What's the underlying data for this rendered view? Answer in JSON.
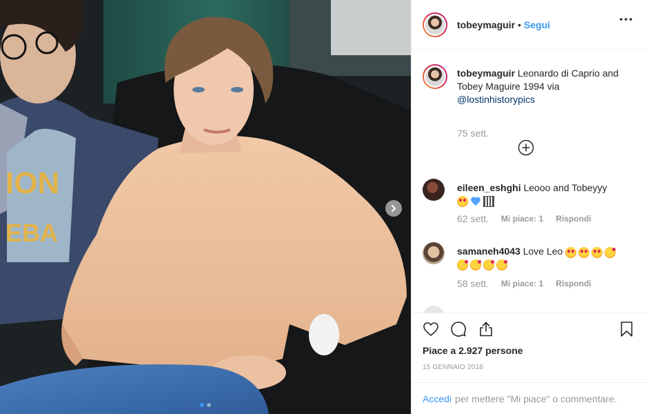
{
  "post": {
    "author": "tobeymaguir",
    "separator": "•",
    "follow_label": "Segui",
    "caption_text": "Leonardo di Caprio and Tobey Maguire 1994 via",
    "caption_mention": "@lostinhistorypics",
    "caption_time": "75 sett.",
    "likes_text": "Piace a 2.927 persone",
    "date": "15 GENNAIO 2018",
    "login_link": "Accedi",
    "login_text": "per mettere \"Mi piace\" o commentare.",
    "carousel_current": 1,
    "carousel_total": 2
  },
  "comments": [
    {
      "user": "eileen_eshghi",
      "text": "Leooo and Tobeyyy",
      "emojis": [
        "heart-eyes-emoji",
        "blue-heart-emoji",
        "qr-emoji"
      ],
      "time": "62 sett.",
      "likes": "Mi piace: 1",
      "reply": "Rispondi"
    },
    {
      "user": "samaneh4043",
      "text": "Love Leo",
      "emojis_inline": [
        "heart-eyes-emoji",
        "heart-eyes-emoji",
        "heart-eyes-emoji",
        "kiss-emoji"
      ],
      "emojis": [
        "kiss-emoji",
        "kiss-emoji",
        "kiss-emoji",
        "kiss-emoji"
      ],
      "time": "58 sett.",
      "likes": "Mi piace: 1",
      "reply": "Rispondi"
    }
  ],
  "icons": {
    "more": "more-horizontal-icon",
    "load_more": "plus-circle-icon",
    "like": "heart-outline-icon",
    "comment": "comment-bubble-icon",
    "share": "share-icon",
    "save": "bookmark-icon",
    "next": "chevron-right-icon"
  },
  "colors": {
    "link_blue": "#3897f0",
    "mention_blue": "#003569",
    "muted": "#999999",
    "text": "#262626"
  }
}
